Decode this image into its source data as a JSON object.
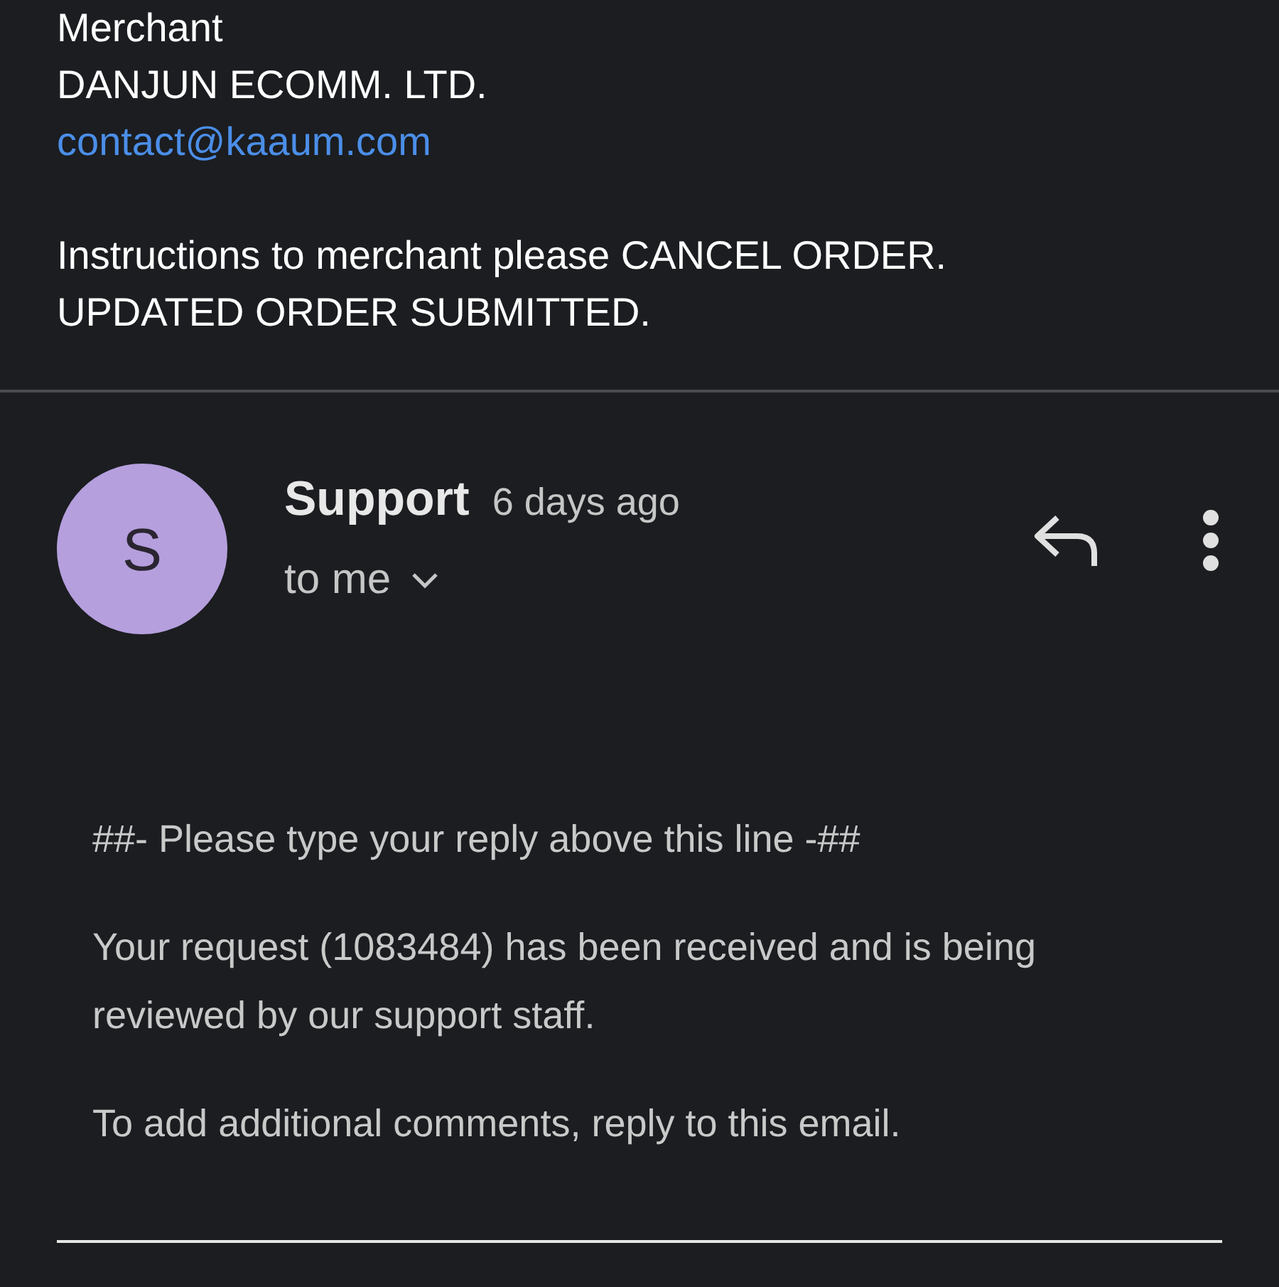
{
  "previous_message": {
    "label": "Merchant",
    "merchant_name": "DANJUN ECOMM. LTD.",
    "email": "contact@kaaum.com",
    "instructions": [
      "Instructions to merchant please CANCEL ORDER.",
      "UPDATED ORDER SUBMITTED."
    ]
  },
  "message": {
    "avatar_letter": "S",
    "sender": "Support",
    "time": "6 days ago",
    "recipient": "to me",
    "body": [
      "##- Please type your reply above this line -##",
      "Your request (1083484) has been received and is being reviewed by our support staff.",
      "To add additional comments, reply to this email."
    ]
  }
}
